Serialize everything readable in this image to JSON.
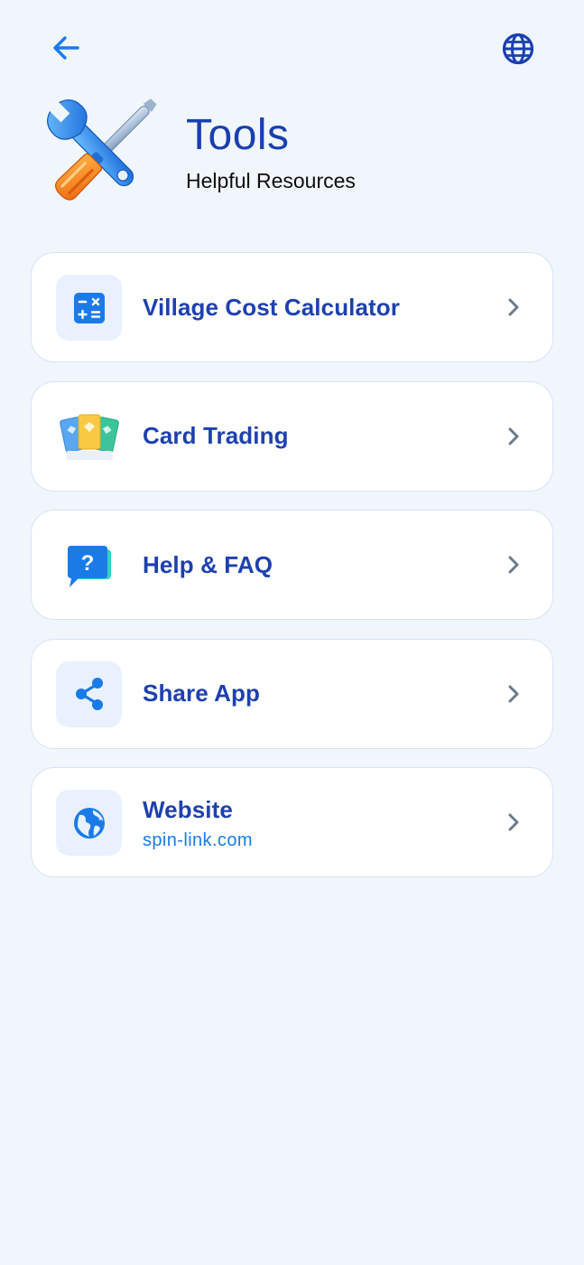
{
  "header": {
    "title": "Tools",
    "subtitle": "Helpful Resources"
  },
  "icons": {
    "back": "arrow-left-icon",
    "language": "globe-icon",
    "chevron": "chevron-right-icon"
  },
  "colors": {
    "background": "#f1f6fd",
    "accent": "#1a7be8",
    "title": "#1a3fb0",
    "card_border": "#d5e3f5",
    "icon_tile": "#e8f1fd"
  },
  "menu": [
    {
      "label": "Village Cost Calculator",
      "icon": "calculator-icon"
    },
    {
      "label": "Card Trading",
      "icon": "cards-icon"
    },
    {
      "label": "Help & FAQ",
      "icon": "help-chat-icon"
    },
    {
      "label": "Share App",
      "icon": "share-icon"
    },
    {
      "label": "Website",
      "sublabel": "spin-link.com",
      "icon": "globe-icon"
    }
  ]
}
